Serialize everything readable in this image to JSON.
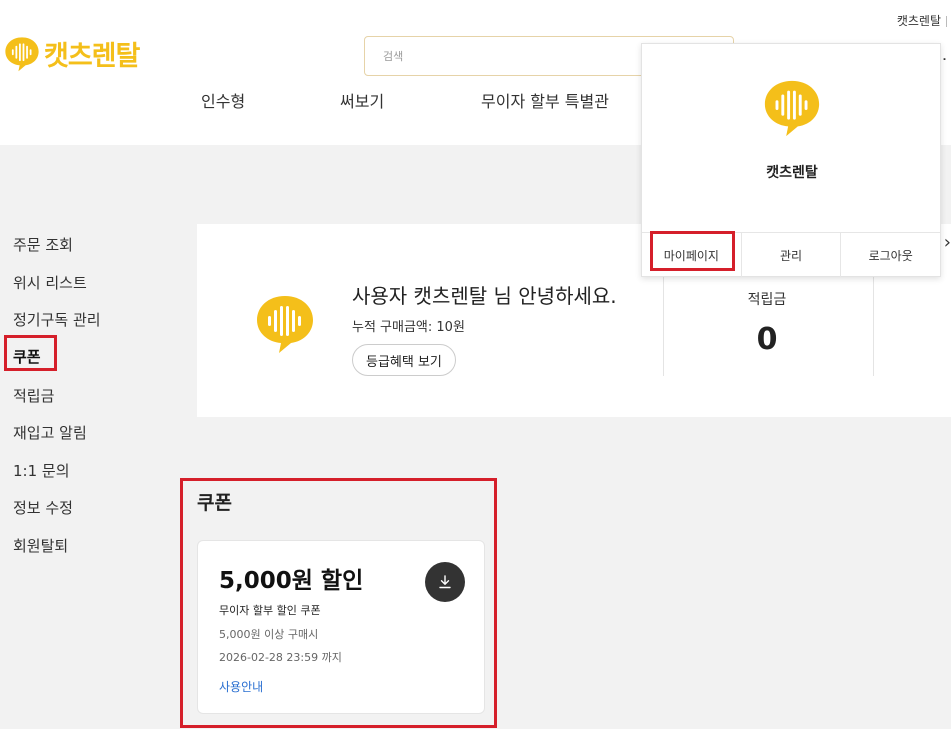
{
  "header": {
    "user_link": "캣츠렌탈",
    "logo_text": "캣츠렌탈",
    "search_placeholder": "검색",
    "nav": [
      "인수형",
      "써보기",
      "무이자 할부 특별관"
    ]
  },
  "sidebar": {
    "items": [
      "주문 조회",
      "위시 리스트",
      "정기구독 관리",
      "쿠폰",
      "적립금",
      "재입고 알림",
      "1:1 문의",
      "정보 수정",
      "회원탈퇴"
    ],
    "active_index": 3
  },
  "profile": {
    "greeting": "사용자 캣츠렌탈 님 안녕하세요.",
    "accumulated": "누적 구매금액: 10원",
    "grade_button": "등급혜택 보기",
    "points_label": "적립금",
    "points_value": "0"
  },
  "popup": {
    "name": "캣츠렌탈",
    "actions": [
      "마이페이지",
      "관리",
      "로그아웃"
    ]
  },
  "coupon": {
    "section_title": "쿠폰",
    "amount": "5,000원 할인",
    "name": "무이자 할부 할인 쿠폰",
    "condition": "5,000원 이상 구매시",
    "expiry": "2026-02-28 23:59 까지",
    "guide_link": "사용안내"
  },
  "colors": {
    "brand_yellow": "#f4bf1a",
    "highlight_red": "#d51f2a",
    "link_blue": "#2a6fd1"
  }
}
